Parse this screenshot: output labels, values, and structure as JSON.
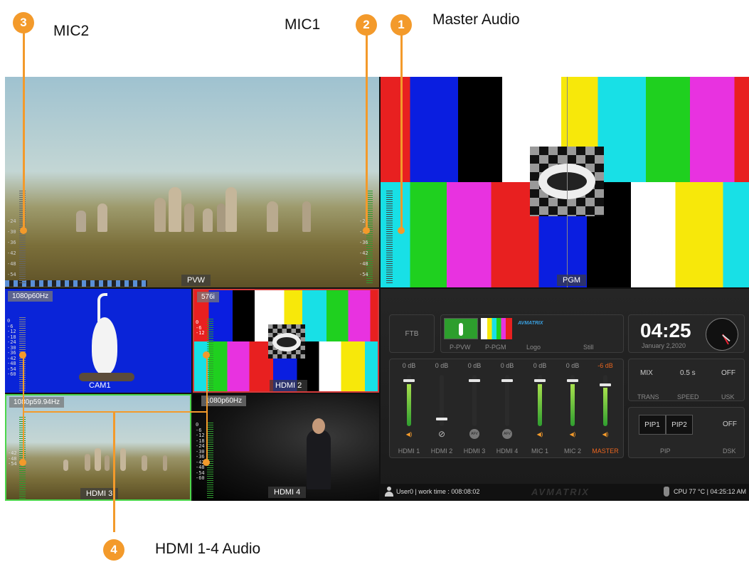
{
  "callouts": [
    {
      "num": "1",
      "label": "Master Audio"
    },
    {
      "num": "2",
      "label": "MIC1"
    },
    {
      "num": "3",
      "label": "MIC2"
    },
    {
      "num": "4",
      "label": "HDMI 1-4 Audio"
    }
  ],
  "monitors": {
    "pvw": "PVW",
    "pgm": "PGM"
  },
  "tiles": [
    {
      "format": "1080p60Hz",
      "label": "CAM1"
    },
    {
      "format": "576i",
      "label": "HDMI 2"
    },
    {
      "format": "1080p59.94Hz",
      "label": "HDMI 3"
    },
    {
      "format": "1080p60Hz",
      "label": "HDMI 4"
    }
  ],
  "meter_scale": [
    "0",
    "-6",
    "-12",
    "-18",
    "-24",
    "-30",
    "-36",
    "-42",
    "-48",
    "-54",
    "-60"
  ],
  "control": {
    "ftb": "FTB",
    "sources": [
      {
        "label": "P-PVW"
      },
      {
        "label": "P-PGM"
      },
      {
        "label": "Logo"
      },
      {
        "label": "Still"
      }
    ],
    "logo_brand": "AVMATRIX",
    "clock": {
      "time": "04:25",
      "date": "January 2,2020"
    },
    "channels": [
      {
        "db": "0 dB",
        "name": "HDMI 1",
        "icon": "speaker-icon",
        "level": 0.82,
        "state": "on"
      },
      {
        "db": "0 dB",
        "name": "HDMI 2",
        "icon": "muted-icon",
        "level": 0.0,
        "state": "off"
      },
      {
        "db": "0 dB",
        "name": "HDMI 3",
        "icon": "afv-icon",
        "level": 0.0,
        "state": "afv"
      },
      {
        "db": "0 dB",
        "name": "HDMI 4",
        "icon": "afv-icon",
        "level": 0.0,
        "state": "afv"
      },
      {
        "db": "0 dB",
        "name": "MIC 1",
        "icon": "speaker-icon",
        "level": 0.82,
        "state": "on"
      },
      {
        "db": "0 dB",
        "name": "MIC 2",
        "icon": "speaker-icon",
        "level": 0.82,
        "state": "on"
      },
      {
        "db": "-6 dB",
        "name": "MASTER",
        "icon": "speaker-icon",
        "level": 0.75,
        "state": "master"
      }
    ],
    "trans": {
      "mix": "MIX",
      "speed": "0.5 s",
      "usk": "OFF",
      "labels": [
        "TRANS",
        "SPEED",
        "USK"
      ]
    },
    "pip": {
      "pip1": "PIP1",
      "pip2": "PIP2",
      "dsk": "OFF",
      "labels": [
        "PIP",
        "DSK"
      ]
    },
    "status": {
      "user": "User0 | work time : 008:08:02",
      "brand": "AVMATRIX",
      "cpu": "CPU 77 °C | 04:25:12 AM"
    }
  },
  "colors": {
    "accent": "#f39a2b",
    "master": "#e8641e",
    "green_border": "#4bd64b",
    "red_border": "#d23a3a"
  }
}
